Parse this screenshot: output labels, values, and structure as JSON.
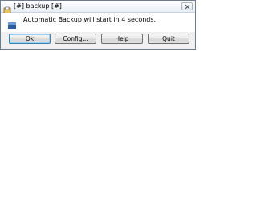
{
  "window": {
    "title": "[#] backup [#]",
    "app_icon": "backup-app-icon",
    "close_icon": "close-icon"
  },
  "dialog": {
    "message": "Automatic Backup will start in 4 seconds.",
    "message_icon": "info-flag-icon"
  },
  "buttons": {
    "ok_label": "Ok",
    "config_label": "Config...",
    "help_label": "Help",
    "quit_label": "Quit"
  },
  "colors": {
    "dialog_background": "#f0f0f0",
    "content_background": "#ffffff",
    "default_button_border": "#3c7fb1"
  }
}
